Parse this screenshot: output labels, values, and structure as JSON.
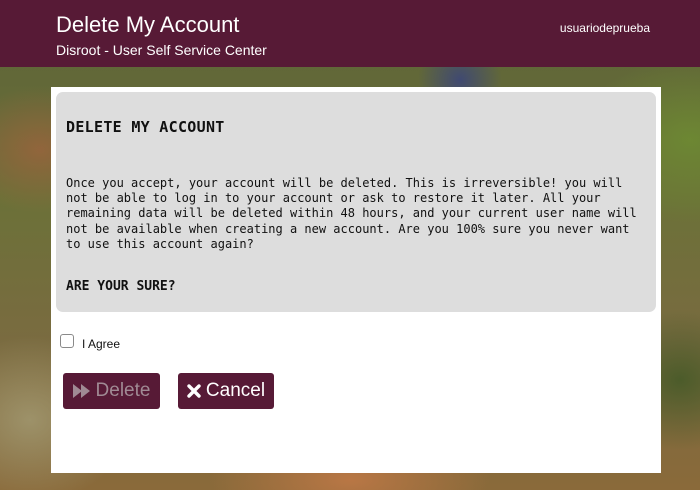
{
  "header": {
    "title": "Delete My Account",
    "subtitle": "Disroot - User Self Service Center",
    "username": "usuariodeprueba"
  },
  "notice": {
    "title": "DELETE MY ACCOUNT",
    "body": "Once you accept, your account will be deleted. This is irreversible! you will not be able to log in to your account or ask to restore it later. All your remaining data will be deleted within 48 hours, and your current user name will not be available when creating a new account. Are you 100% sure you never want to use this account again?",
    "question": "ARE YOUR SURE?"
  },
  "form": {
    "agree_label": "I Agree",
    "agree_checked": false,
    "delete_label": "Delete",
    "delete_icon": "fast-forward-icon",
    "delete_disabled": true,
    "cancel_label": "Cancel",
    "cancel_icon": "close-icon"
  },
  "colors": {
    "brand": "#571a36",
    "notice_bg": "#dddddd",
    "disabled_text": "#a08a94"
  }
}
